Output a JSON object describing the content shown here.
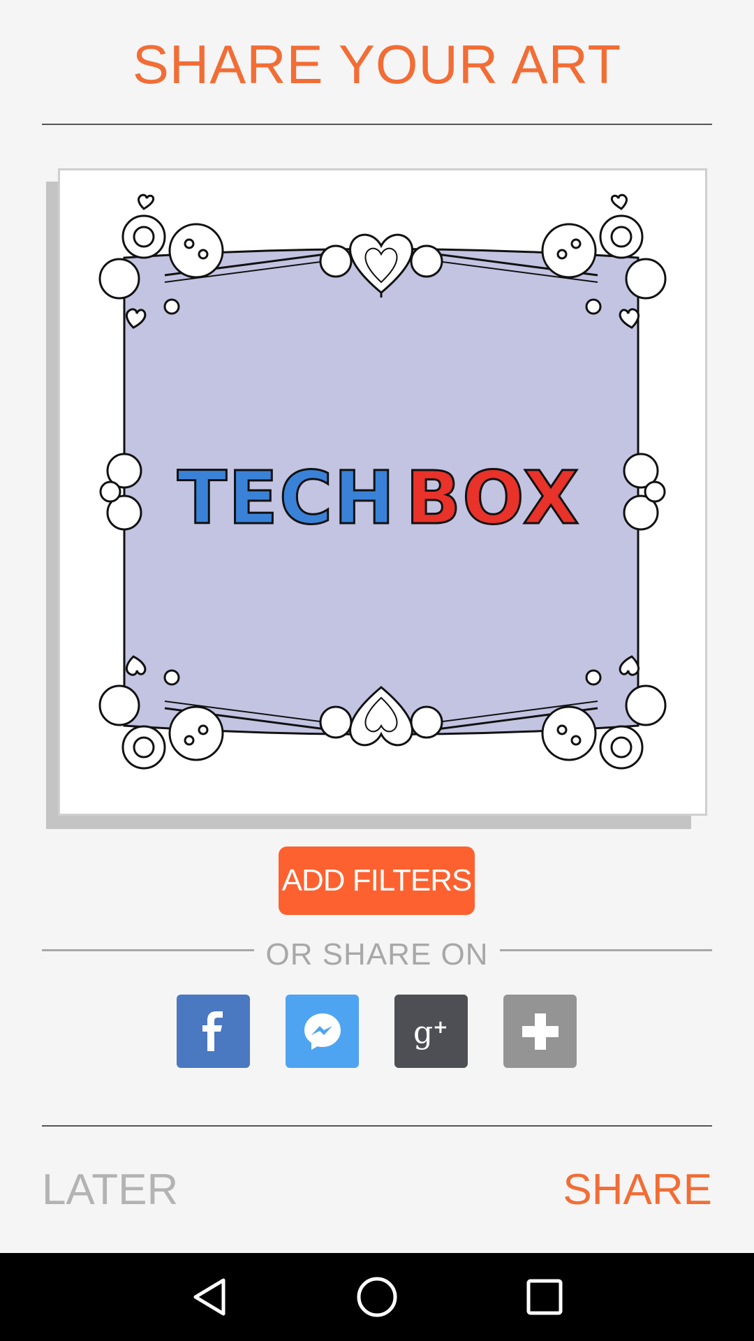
{
  "header": {
    "title": "SHARE YOUR ART"
  },
  "artwork": {
    "logo_part_1": "TECH",
    "logo_part_2": "BOX",
    "background_color": "#c3c4e2",
    "logo_color_1": "#3a82d8",
    "logo_color_2": "#e8322a"
  },
  "actions": {
    "add_filters_label": "ADD FILTERS",
    "or_share_on_label": "OR SHARE ON",
    "later_label": "LATER",
    "share_label": "SHARE"
  },
  "share_targets": [
    {
      "name": "facebook",
      "icon": "facebook-icon",
      "color": "#4a78c1"
    },
    {
      "name": "messenger",
      "icon": "messenger-icon",
      "color": "#4ea4f0"
    },
    {
      "name": "google-plus",
      "icon": "google-plus-icon",
      "color": "#4d4f54"
    },
    {
      "name": "more",
      "icon": "plus-icon",
      "color": "#949494"
    }
  ],
  "colors": {
    "accent": "#f26d35",
    "button": "#fd612f",
    "muted_text": "#a8a8a8"
  },
  "system_nav": {
    "back_icon": "back-triangle-icon",
    "home_icon": "home-circle-icon",
    "recents_icon": "recents-square-icon"
  }
}
